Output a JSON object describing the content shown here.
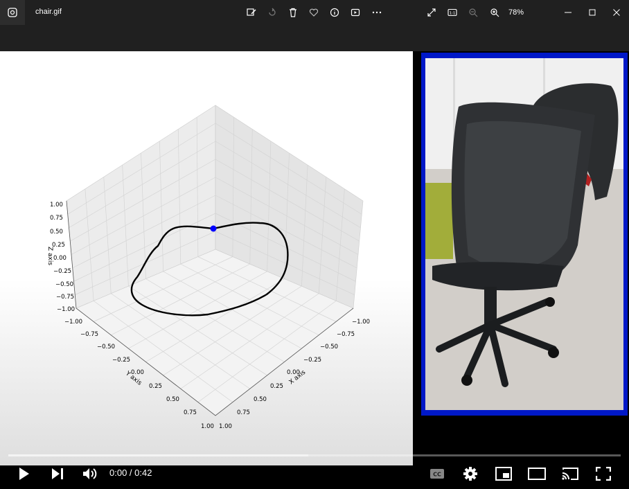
{
  "window": {
    "title": "chair.gif",
    "zoom_label": "78%"
  },
  "toolbar": {
    "icons": [
      "edit-image-icon",
      "rotate-icon",
      "delete-icon",
      "favorite-icon",
      "info-icon",
      "slideshow-icon",
      "more-icon"
    ],
    "right_icons": [
      "full-screen-icon",
      "actual-size-icon",
      "zoom-out-icon",
      "zoom-in-icon"
    ]
  },
  "plot": {
    "z_label": "Z axis",
    "y_label": "Y axis",
    "x_label": "X axis",
    "z_ticks": [
      "1.00",
      "0.75",
      "0.50",
      "0.25",
      "0.00",
      "−0.25",
      "−0.50",
      "−0.75",
      "−1.00"
    ],
    "y_ticks": [
      "−1.00",
      "−0.75",
      "−0.50",
      "−0.25",
      "0.00",
      "0.25",
      "0.50",
      "0.75",
      "1.00"
    ],
    "x_ticks": [
      "−1.00",
      "−0.75",
      "−0.50",
      "−0.25",
      "0.00",
      "0.25",
      "0.50",
      "0.75",
      "1.00"
    ],
    "trajectory_color": "#000000",
    "marker_color": "#0000ff"
  },
  "video_frame": {
    "border_color": "#0018c8",
    "subject": "office chair"
  },
  "player": {
    "current_time": "0:00 / 0:42",
    "progress_loaded_fraction": 0.49,
    "progress_played_fraction": 0.0,
    "controls": [
      "play-icon",
      "next-icon",
      "volume-icon",
      "captions-icon",
      "settings-icon",
      "miniplayer-icon",
      "theater-icon",
      "cast-icon",
      "fullscreen-icon"
    ]
  }
}
